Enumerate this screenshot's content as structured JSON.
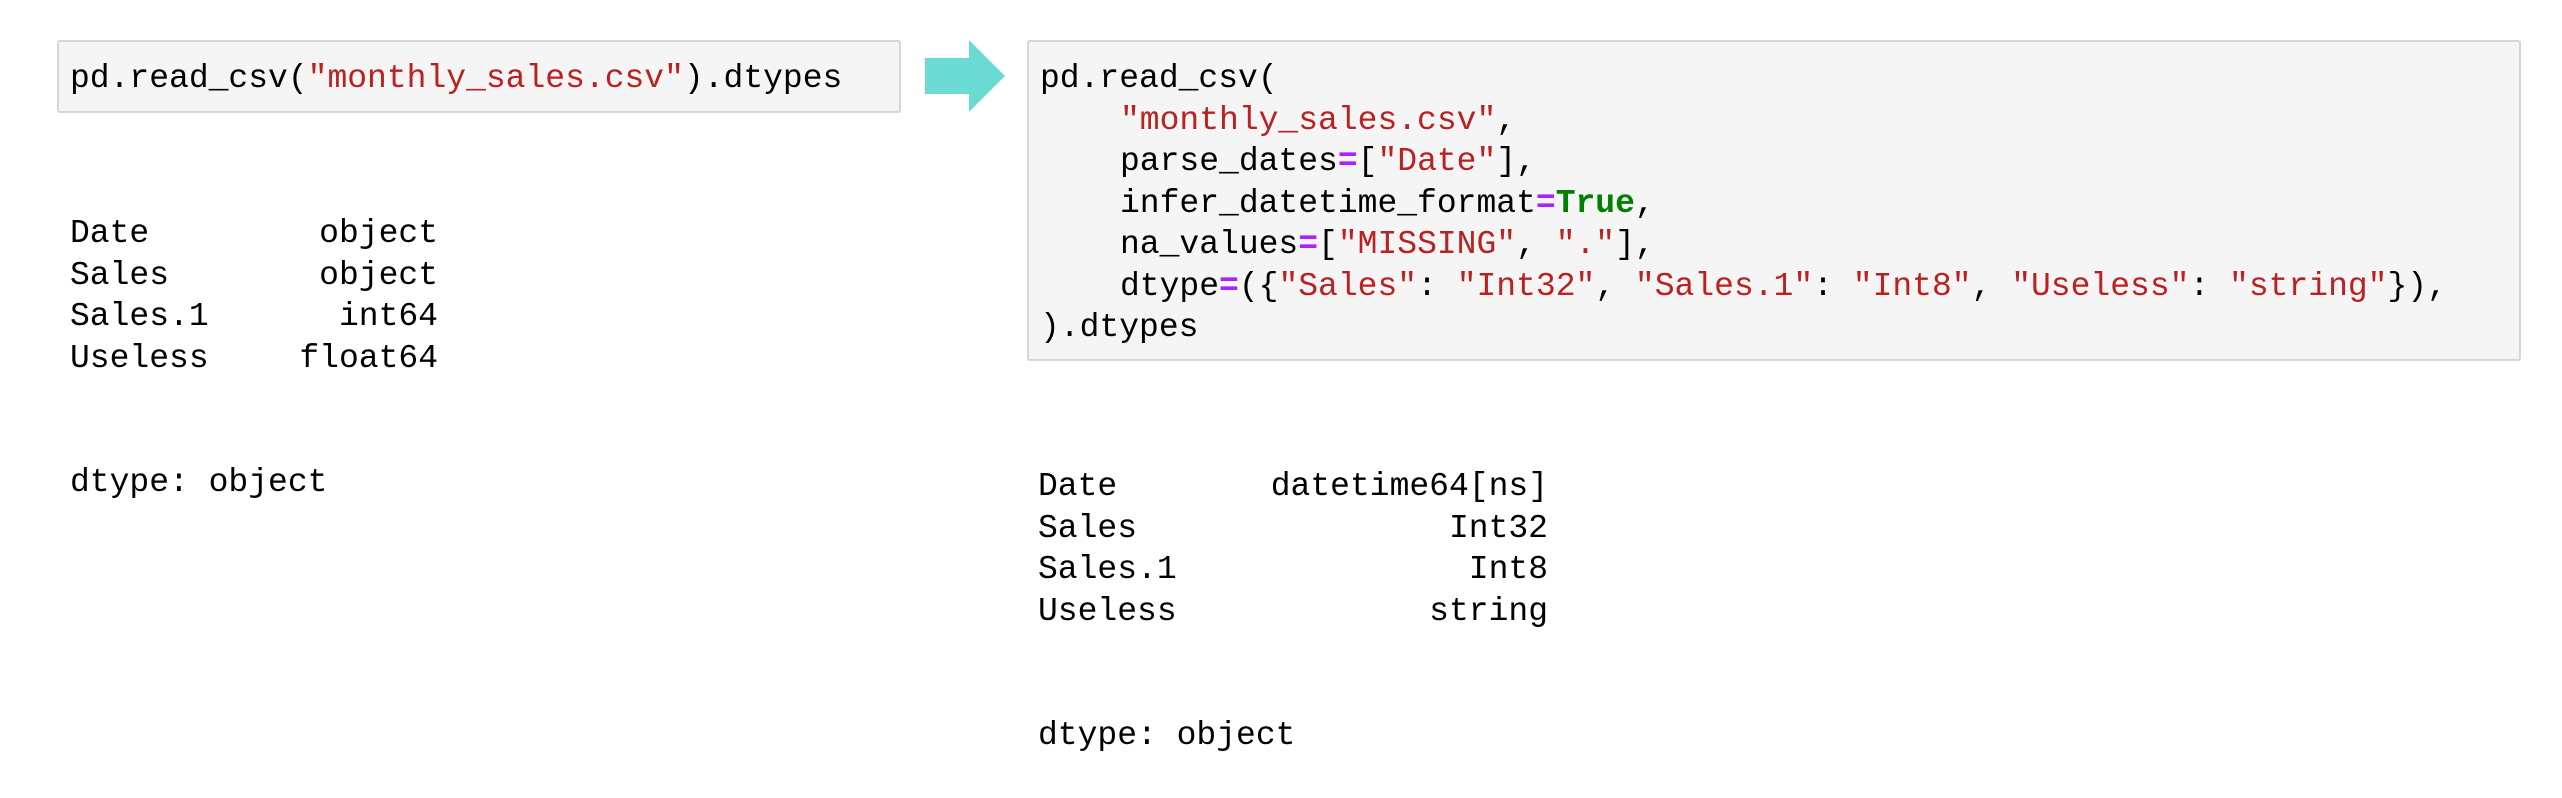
{
  "input_left": {
    "tokens": [
      {
        "text": "pd.read_csv(",
        "cls": ""
      },
      {
        "text": "\"monthly_sales.csv\"",
        "cls": "str"
      },
      {
        "text": ").dtypes",
        "cls": ""
      }
    ]
  },
  "output_left": {
    "rows": [
      {
        "key": "Date",
        "val": "object"
      },
      {
        "key": "Sales",
        "val": "object"
      },
      {
        "key": "Sales.1",
        "val": "int64"
      },
      {
        "key": "Useless",
        "val": "float64"
      }
    ],
    "footer": "dtype: object"
  },
  "arrow": {
    "icon": "right-arrow-icon",
    "color": "#6ddbd5"
  },
  "input_right": {
    "lines": [
      {
        "indent": false,
        "tokens": [
          {
            "text": "pd.read_csv(",
            "cls": ""
          }
        ]
      },
      {
        "indent": true,
        "tokens": [
          {
            "text": "\"monthly_sales.csv\"",
            "cls": "str"
          },
          {
            "text": ",",
            "cls": ""
          }
        ]
      },
      {
        "indent": true,
        "tokens": [
          {
            "text": "parse_dates",
            "cls": ""
          },
          {
            "text": "=",
            "cls": "op"
          },
          {
            "text": "[",
            "cls": ""
          },
          {
            "text": "\"Date\"",
            "cls": "str"
          },
          {
            "text": "],",
            "cls": ""
          }
        ]
      },
      {
        "indent": true,
        "tokens": [
          {
            "text": "infer_datetime_format",
            "cls": ""
          },
          {
            "text": "=",
            "cls": "op"
          },
          {
            "text": "True",
            "cls": "kw"
          },
          {
            "text": ",",
            "cls": ""
          }
        ]
      },
      {
        "indent": true,
        "tokens": [
          {
            "text": "na_values",
            "cls": ""
          },
          {
            "text": "=",
            "cls": "op"
          },
          {
            "text": "[",
            "cls": ""
          },
          {
            "text": "\"MISSING\"",
            "cls": "str"
          },
          {
            "text": ", ",
            "cls": ""
          },
          {
            "text": "\".\"",
            "cls": "str"
          },
          {
            "text": "],",
            "cls": ""
          }
        ]
      },
      {
        "indent": true,
        "tokens": [
          {
            "text": "dtype",
            "cls": ""
          },
          {
            "text": "=",
            "cls": "op"
          },
          {
            "text": "({",
            "cls": ""
          },
          {
            "text": "\"Sales\"",
            "cls": "str"
          },
          {
            "text": ": ",
            "cls": ""
          },
          {
            "text": "\"Int32\"",
            "cls": "str"
          },
          {
            "text": ", ",
            "cls": ""
          },
          {
            "text": "\"Sales.1\"",
            "cls": "str"
          },
          {
            "text": ": ",
            "cls": ""
          },
          {
            "text": "\"Int8\"",
            "cls": "str"
          },
          {
            "text": ", ",
            "cls": ""
          },
          {
            "text": "\"Useless\"",
            "cls": "str"
          },
          {
            "text": ": ",
            "cls": ""
          },
          {
            "text": "\"string\"",
            "cls": "str"
          },
          {
            "text": "}),",
            "cls": ""
          }
        ]
      },
      {
        "indent": false,
        "tokens": [
          {
            "text": ").dtypes",
            "cls": ""
          }
        ]
      }
    ]
  },
  "output_right": {
    "rows": [
      {
        "key": "Date",
        "val": "datetime64[ns]"
      },
      {
        "key": "Sales",
        "val": "Int32"
      },
      {
        "key": "Sales.1",
        "val": "Int8"
      },
      {
        "key": "Useless",
        "val": "string"
      }
    ],
    "footer": "dtype: object"
  }
}
